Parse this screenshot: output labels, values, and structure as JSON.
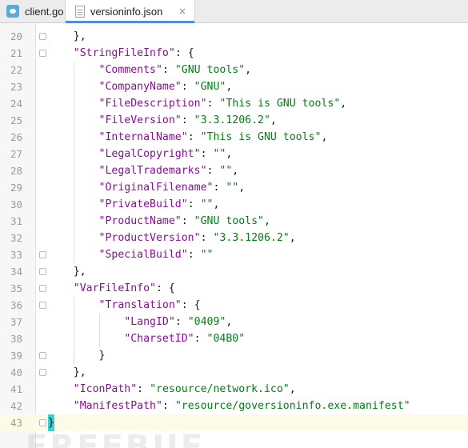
{
  "tabs": [
    {
      "label": "client.go",
      "icon": "go-file-icon",
      "active": false
    },
    {
      "label": "versioninfo.json",
      "icon": "json-file-icon",
      "active": true,
      "close": "×"
    }
  ],
  "editor": {
    "current_line": 43,
    "lines": [
      {
        "no": "20",
        "tokens": [
          {
            "t": "    },",
            "c": "p"
          }
        ]
      },
      {
        "no": "21",
        "tokens": [
          {
            "t": "    ",
            "c": "p"
          },
          {
            "t": "\"StringFileInfo\"",
            "c": "k"
          },
          {
            "t": ": {",
            "c": "p"
          }
        ]
      },
      {
        "no": "22",
        "tokens": [
          {
            "t": "        ",
            "c": "p"
          },
          {
            "t": "\"Comments\"",
            "c": "k"
          },
          {
            "t": ": ",
            "c": "p"
          },
          {
            "t": "\"GNU tools\"",
            "c": "s"
          },
          {
            "t": ",",
            "c": "p"
          }
        ]
      },
      {
        "no": "23",
        "tokens": [
          {
            "t": "        ",
            "c": "p"
          },
          {
            "t": "\"CompanyName\"",
            "c": "k"
          },
          {
            "t": ": ",
            "c": "p"
          },
          {
            "t": "\"GNU\"",
            "c": "s"
          },
          {
            "t": ",",
            "c": "p"
          }
        ]
      },
      {
        "no": "24",
        "tokens": [
          {
            "t": "        ",
            "c": "p"
          },
          {
            "t": "\"FileDescription\"",
            "c": "k"
          },
          {
            "t": ": ",
            "c": "p"
          },
          {
            "t": "\"This is GNU tools\"",
            "c": "s"
          },
          {
            "t": ",",
            "c": "p"
          }
        ]
      },
      {
        "no": "25",
        "tokens": [
          {
            "t": "        ",
            "c": "p"
          },
          {
            "t": "\"FileVersion\"",
            "c": "k"
          },
          {
            "t": ": ",
            "c": "p"
          },
          {
            "t": "\"3.3.1206.2\"",
            "c": "s"
          },
          {
            "t": ",",
            "c": "p"
          }
        ]
      },
      {
        "no": "26",
        "tokens": [
          {
            "t": "        ",
            "c": "p"
          },
          {
            "t": "\"InternalName\"",
            "c": "k"
          },
          {
            "t": ": ",
            "c": "p"
          },
          {
            "t": "\"This is GNU tools\"",
            "c": "s"
          },
          {
            "t": ",",
            "c": "p"
          }
        ]
      },
      {
        "no": "27",
        "tokens": [
          {
            "t": "        ",
            "c": "p"
          },
          {
            "t": "\"LegalCopyright\"",
            "c": "k"
          },
          {
            "t": ": ",
            "c": "p"
          },
          {
            "t": "\"\"",
            "c": "s"
          },
          {
            "t": ",",
            "c": "p"
          }
        ]
      },
      {
        "no": "28",
        "tokens": [
          {
            "t": "        ",
            "c": "p"
          },
          {
            "t": "\"LegalTrademarks\"",
            "c": "k"
          },
          {
            "t": ": ",
            "c": "p"
          },
          {
            "t": "\"\"",
            "c": "s"
          },
          {
            "t": ",",
            "c": "p"
          }
        ]
      },
      {
        "no": "29",
        "tokens": [
          {
            "t": "        ",
            "c": "p"
          },
          {
            "t": "\"OriginalFilename\"",
            "c": "k"
          },
          {
            "t": ": ",
            "c": "p"
          },
          {
            "t": "\"\"",
            "c": "s"
          },
          {
            "t": ",",
            "c": "p"
          }
        ]
      },
      {
        "no": "30",
        "tokens": [
          {
            "t": "        ",
            "c": "p"
          },
          {
            "t": "\"PrivateBuild\"",
            "c": "k"
          },
          {
            "t": ": ",
            "c": "p"
          },
          {
            "t": "\"\"",
            "c": "s"
          },
          {
            "t": ",",
            "c": "p"
          }
        ]
      },
      {
        "no": "31",
        "tokens": [
          {
            "t": "        ",
            "c": "p"
          },
          {
            "t": "\"ProductName\"",
            "c": "k"
          },
          {
            "t": ": ",
            "c": "p"
          },
          {
            "t": "\"GNU tools\"",
            "c": "s"
          },
          {
            "t": ",",
            "c": "p"
          }
        ]
      },
      {
        "no": "32",
        "tokens": [
          {
            "t": "        ",
            "c": "p"
          },
          {
            "t": "\"ProductVersion\"",
            "c": "k"
          },
          {
            "t": ": ",
            "c": "p"
          },
          {
            "t": "\"3.3.1206.2\"",
            "c": "s"
          },
          {
            "t": ",",
            "c": "p"
          }
        ]
      },
      {
        "no": "33",
        "tokens": [
          {
            "t": "        ",
            "c": "p"
          },
          {
            "t": "\"SpecialBuild\"",
            "c": "k"
          },
          {
            "t": ": ",
            "c": "p"
          },
          {
            "t": "\"\"",
            "c": "s"
          }
        ]
      },
      {
        "no": "34",
        "tokens": [
          {
            "t": "    },",
            "c": "p"
          }
        ]
      },
      {
        "no": "35",
        "tokens": [
          {
            "t": "    ",
            "c": "p"
          },
          {
            "t": "\"VarFileInfo\"",
            "c": "k"
          },
          {
            "t": ": {",
            "c": "p"
          }
        ]
      },
      {
        "no": "36",
        "tokens": [
          {
            "t": "        ",
            "c": "p"
          },
          {
            "t": "\"Translation\"",
            "c": "k"
          },
          {
            "t": ": {",
            "c": "p"
          }
        ]
      },
      {
        "no": "37",
        "tokens": [
          {
            "t": "            ",
            "c": "p"
          },
          {
            "t": "\"LangID\"",
            "c": "k"
          },
          {
            "t": ": ",
            "c": "p"
          },
          {
            "t": "\"0409\"",
            "c": "s"
          },
          {
            "t": ",",
            "c": "p"
          }
        ]
      },
      {
        "no": "38",
        "tokens": [
          {
            "t": "            ",
            "c": "p"
          },
          {
            "t": "\"CharsetID\"",
            "c": "k"
          },
          {
            "t": ": ",
            "c": "p"
          },
          {
            "t": "\"04B0\"",
            "c": "s"
          }
        ]
      },
      {
        "no": "39",
        "tokens": [
          {
            "t": "        }",
            "c": "p"
          }
        ]
      },
      {
        "no": "40",
        "tokens": [
          {
            "t": "    },",
            "c": "p"
          }
        ]
      },
      {
        "no": "41",
        "tokens": [
          {
            "t": "    ",
            "c": "p"
          },
          {
            "t": "\"IconPath\"",
            "c": "k"
          },
          {
            "t": ": ",
            "c": "p"
          },
          {
            "t": "\"resource/network.ico\"",
            "c": "s"
          },
          {
            "t": ",",
            "c": "p"
          }
        ]
      },
      {
        "no": "42",
        "tokens": [
          {
            "t": "    ",
            "c": "p"
          },
          {
            "t": "\"ManifestPath\"",
            "c": "k"
          },
          {
            "t": ": ",
            "c": "p"
          },
          {
            "t": "\"resource/goversioninfo.exe.manifest\"",
            "c": "s"
          }
        ]
      },
      {
        "no": "43",
        "tokens": [
          {
            "t": "}",
            "c": "caret"
          }
        ]
      }
    ]
  },
  "watermark": "FREEBUF",
  "colors": {
    "key": "#871094",
    "string": "#067d17",
    "tab_accent": "#4a8fd8",
    "brace_highlight": "#3bd0d6"
  }
}
